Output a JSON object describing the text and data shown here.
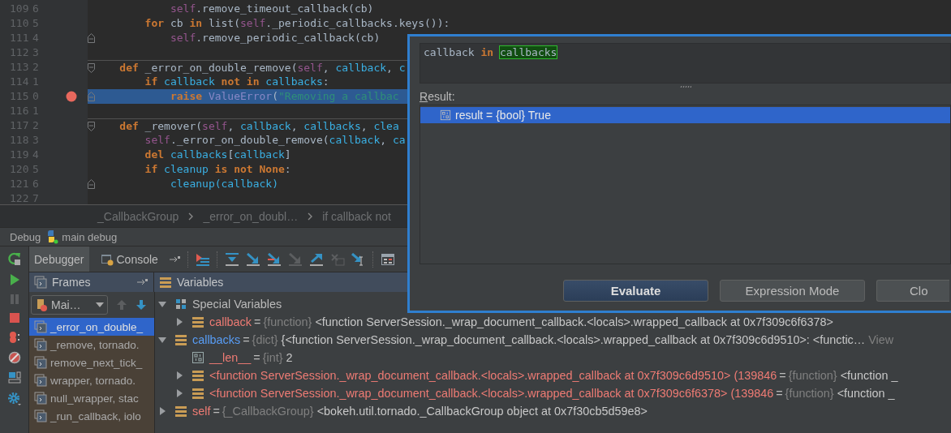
{
  "editor": {
    "lines": [
      {
        "number": "109",
        "relative": "6",
        "breakpoint": false,
        "current": false,
        "separator": false,
        "fold_start": false,
        "fold_end": false,
        "tokens": [
          {
            "text": "            self",
            "kind": "self"
          },
          {
            "text": ".remove_timeout_callback(cb)",
            "kind": "plain"
          }
        ]
      },
      {
        "number": "110",
        "relative": "5",
        "breakpoint": false,
        "current": false,
        "separator": false,
        "fold_start": false,
        "fold_end": false,
        "tokens": [
          {
            "text": "        for",
            "kind": "kw"
          },
          {
            "text": " cb ",
            "kind": "plain"
          },
          {
            "text": "in",
            "kind": "kw"
          },
          {
            "text": " list(",
            "kind": "plain"
          },
          {
            "text": "self",
            "kind": "self"
          },
          {
            "text": "._periodic_callbacks.keys()):",
            "kind": "plain"
          }
        ]
      },
      {
        "number": "111",
        "relative": "4",
        "breakpoint": false,
        "current": false,
        "separator": false,
        "fold_start": false,
        "fold_end": true,
        "tokens": [
          {
            "text": "            self",
            "kind": "self"
          },
          {
            "text": ".remove_periodic_callback(cb)",
            "kind": "plain"
          }
        ]
      },
      {
        "number": "112",
        "relative": "3",
        "breakpoint": false,
        "current": false,
        "separator": false,
        "fold_start": false,
        "fold_end": false
      },
      {
        "number": "113",
        "relative": "2",
        "breakpoint": false,
        "current": false,
        "separator": true,
        "fold_start": true,
        "fold_end": false,
        "tokens": [
          {
            "text": "    def",
            "kind": "kw"
          },
          {
            "text": " _error_on_double_remove(",
            "kind": "plain"
          },
          {
            "text": "self",
            "kind": "self"
          },
          {
            "text": ", ",
            "kind": "plain"
          },
          {
            "text": "callback",
            "kind": "param"
          },
          {
            "text": ", ",
            "kind": "plain"
          },
          {
            "text": "c",
            "kind": "param"
          }
        ]
      },
      {
        "number": "114",
        "relative": "1",
        "breakpoint": false,
        "current": false,
        "separator": false,
        "fold_start": false,
        "fold_end": false,
        "tokens": [
          {
            "text": "        if",
            "kind": "kw"
          },
          {
            "text": " callback ",
            "kind": "param"
          },
          {
            "text": "not",
            "kind": "kw"
          },
          {
            "text": " in",
            "kind": "kw"
          },
          {
            "text": " callbacks",
            "kind": "param"
          },
          {
            "text": ":",
            "kind": "plain"
          }
        ]
      },
      {
        "number": "115",
        "relative": "0",
        "breakpoint": true,
        "current": true,
        "separator": false,
        "fold_start": false,
        "fold_end": true,
        "tokens": [
          {
            "text": "            raise",
            "kind": "kw"
          },
          {
            "text": " ValueError",
            "kind": "builtin"
          },
          {
            "text": "(",
            "kind": "plain"
          },
          {
            "text": "\"Removing a callbac",
            "kind": "str"
          }
        ]
      },
      {
        "number": "116",
        "relative": "1",
        "breakpoint": false,
        "current": false,
        "separator": false,
        "fold_start": false,
        "fold_end": false
      },
      {
        "number": "117",
        "relative": "2",
        "breakpoint": false,
        "current": false,
        "separator": true,
        "fold_start": true,
        "fold_end": false,
        "tokens": [
          {
            "text": "    def",
            "kind": "kw"
          },
          {
            "text": " _remover(",
            "kind": "plain"
          },
          {
            "text": "self",
            "kind": "self"
          },
          {
            "text": ", ",
            "kind": "plain"
          },
          {
            "text": "callback",
            "kind": "param"
          },
          {
            "text": ", ",
            "kind": "plain"
          },
          {
            "text": "callbacks",
            "kind": "param"
          },
          {
            "text": ", ",
            "kind": "plain"
          },
          {
            "text": "clea",
            "kind": "param"
          }
        ]
      },
      {
        "number": "118",
        "relative": "3",
        "breakpoint": false,
        "current": false,
        "separator": false,
        "fold_start": false,
        "fold_end": false,
        "tokens": [
          {
            "text": "        self",
            "kind": "self"
          },
          {
            "text": "._error_on_double_remove(",
            "kind": "plain"
          },
          {
            "text": "callback",
            "kind": "param"
          },
          {
            "text": ", ",
            "kind": "plain"
          },
          {
            "text": "ca",
            "kind": "param"
          }
        ]
      },
      {
        "number": "119",
        "relative": "4",
        "breakpoint": false,
        "current": false,
        "separator": false,
        "fold_start": false,
        "fold_end": false,
        "tokens": [
          {
            "text": "        del",
            "kind": "kw"
          },
          {
            "text": " callbacks",
            "kind": "param"
          },
          {
            "text": "[",
            "kind": "plain"
          },
          {
            "text": "callback",
            "kind": "param"
          },
          {
            "text": "]",
            "kind": "plain"
          }
        ]
      },
      {
        "number": "120",
        "relative": "5",
        "breakpoint": false,
        "current": false,
        "separator": false,
        "fold_start": false,
        "fold_end": false,
        "tokens": [
          {
            "text": "        if",
            "kind": "kw"
          },
          {
            "text": " cleanup ",
            "kind": "param"
          },
          {
            "text": "is",
            "kind": "kw"
          },
          {
            "text": " not",
            "kind": "kw"
          },
          {
            "text": " None",
            "kind": "kw"
          },
          {
            "text": ":",
            "kind": "plain"
          }
        ]
      },
      {
        "number": "121",
        "relative": "6",
        "breakpoint": false,
        "current": false,
        "separator": false,
        "fold_start": false,
        "fold_end": true,
        "tokens": [
          {
            "text": "            cleanup(callback)",
            "kind": "param"
          }
        ]
      },
      {
        "number": "122",
        "relative": "7",
        "breakpoint": false,
        "current": false,
        "separator": false,
        "fold_start": false,
        "fold_end": false
      }
    ]
  },
  "breadcrumbs": [
    "_CallbackGroup",
    "_error_on_doubl…",
    "if callback not"
  ],
  "debug_panel": {
    "title": "Debug",
    "config": "main debug",
    "tabs": [
      {
        "label": "Debugger",
        "selected": true
      },
      {
        "label": "Console",
        "selected": false
      }
    ],
    "frames": {
      "title": "Frames",
      "thread": "Mai…",
      "items": [
        {
          "label": "_error_on_double_",
          "selected": true
        },
        {
          "label": "_remove, tornado.",
          "selected": false
        },
        {
          "label": "remove_next_tick_",
          "selected": false
        },
        {
          "label": "wrapper, tornado.",
          "selected": false
        },
        {
          "label": "null_wrapper, stac",
          "selected": false
        },
        {
          "label": "_run_callback, iolo",
          "selected": false
        }
      ]
    },
    "variables": {
      "title": "Variables",
      "items": [
        {
          "kind": "group",
          "name": "Special Variables",
          "color": "#bbbbbb",
          "expanded": true,
          "children": [
            {
              "kind": "object",
              "name": "callback",
              "color": "#ee7b74",
              "eq": "=",
              "type": "{function}",
              "value": "<function ServerSession._wrap_document_callback.<locals>.wrapped_callback at 0x7f309c6f6378>",
              "expanded": false
            }
          ]
        },
        {
          "kind": "object",
          "name": "callbacks",
          "color": "#589df6",
          "eq": "=",
          "type": "{dict}",
          "value": "{<function ServerSession._wrap_document_callback.<locals>.wrapped_callback at 0x7f309c6d9510>: <functic…",
          "link": "View",
          "expanded": true,
          "children": [
            {
              "kind": "primitive",
              "name": "__len__",
              "color": "#ee7b74",
              "eq": "=",
              "type": "{int}",
              "value": "2"
            },
            {
              "kind": "object",
              "name": "<function ServerSession._wrap_document_callback.<locals>.wrapped_callback at 0x7f309c6d9510> (139846",
              "color": "#ee7b74",
              "eq": "=",
              "type": "{function}",
              "value": "<function _",
              "expanded": false
            },
            {
              "kind": "object",
              "name": "<function ServerSession._wrap_document_callback.<locals>.wrapped_callback at 0x7f309c6f6378> (139846",
              "color": "#ee7b74",
              "eq": "=",
              "type": "{function}",
              "value": "<function _",
              "expanded": false
            }
          ]
        },
        {
          "kind": "object",
          "name": "self",
          "color": "#ee7b74",
          "eq": "=",
          "type": "{_CallbackGroup}",
          "value": "<bokeh.util.tornado._CallbackGroup object at 0x7f30cb5d59e8>",
          "expanded": false
        }
      ]
    }
  },
  "evaluate_dialog": {
    "expression": [
      {
        "text": "callback ",
        "kind": "plain"
      },
      {
        "text": "in ",
        "kind": "kw"
      },
      {
        "text": "callbacks",
        "kind": "match"
      }
    ],
    "result_label": "Result:",
    "result": {
      "text": "result = {bool} True",
      "selected": true
    },
    "buttons": [
      {
        "label": "Evaluate",
        "default": true
      },
      {
        "label": "Expression Mode",
        "default": false
      },
      {
        "label": "Clo",
        "default": false
      }
    ]
  }
}
